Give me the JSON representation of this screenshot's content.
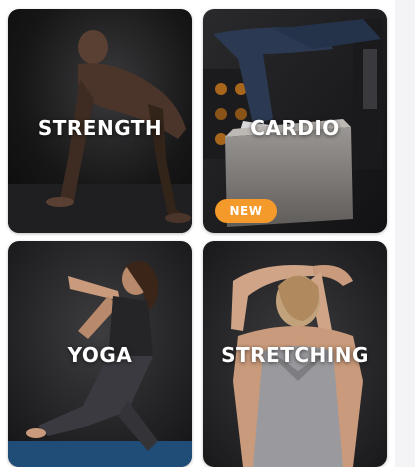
{
  "categories": [
    {
      "id": "strength",
      "label": "STRENGTH"
    },
    {
      "id": "cardio",
      "label": "CARDIO",
      "badge": "NEW"
    },
    {
      "id": "yoga",
      "label": "YOGA"
    },
    {
      "id": "stretching",
      "label": "STRETCHING"
    }
  ],
  "colors": {
    "badge": "#f39a2b",
    "card_text": "#ffffff"
  }
}
